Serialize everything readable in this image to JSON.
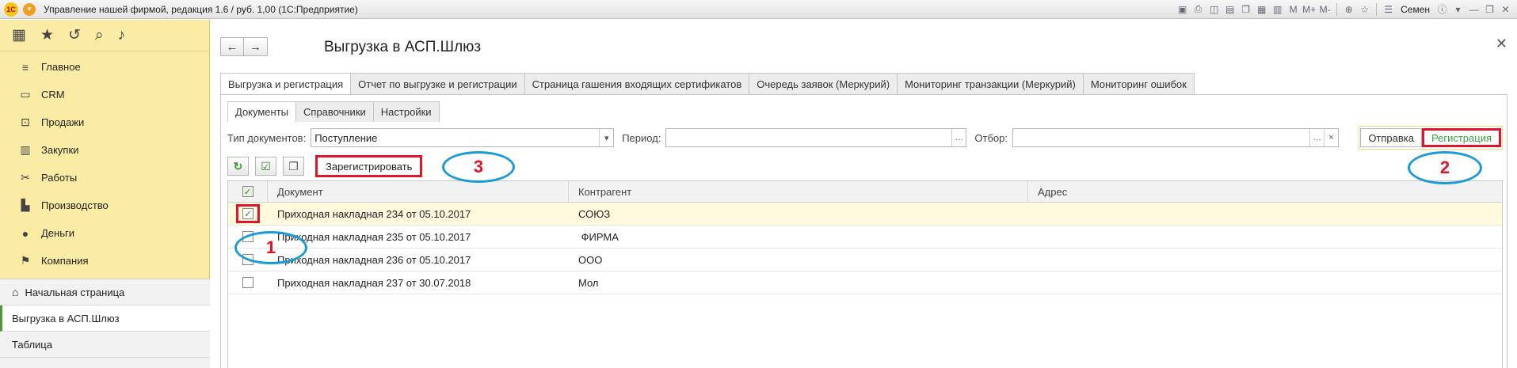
{
  "window": {
    "title": "Управление нашей фирмой, редакция 1.6 / руб. 1,00  (1С:Предприятие)",
    "user": "Семен",
    "app_badge": "1С"
  },
  "sidebar": {
    "items": [
      {
        "label": "Главное",
        "icon": "lines-icon"
      },
      {
        "label": "CRM",
        "icon": "crm-icon"
      },
      {
        "label": "Продажи",
        "icon": "cart-icon"
      },
      {
        "label": "Закупки",
        "icon": "barcode-icon"
      },
      {
        "label": "Работы",
        "icon": "tools-icon"
      },
      {
        "label": "Производство",
        "icon": "factory-icon"
      },
      {
        "label": "Деньги",
        "icon": "money-icon"
      },
      {
        "label": "Компания",
        "icon": "flag-icon"
      }
    ],
    "bottom": {
      "home": "Начальная страница",
      "current": "Выгрузка в АСП.Шлюз",
      "table": "Таблица"
    }
  },
  "page": {
    "title": "Выгрузка в АСП.Шлюз"
  },
  "tabs": [
    "Выгрузка и регистрация",
    "Отчет по выгрузке и регистрации",
    "Страница гашения входящих сертификатов",
    "Очередь заявок (Меркурий)",
    "Мониторинг транзакции (Меркурий)",
    "Мониторинг ошибок"
  ],
  "subtabs": [
    "Документы",
    "Справочники",
    "Настройки"
  ],
  "filters": {
    "doc_type_label": "Тип документов:",
    "doc_type_value": "Поступление",
    "period_label": "Период:",
    "period_value": "",
    "filter_label": "Отбор:",
    "filter_value": "",
    "toggle_send": "Отправка",
    "toggle_register": "Регистрация"
  },
  "commands": {
    "register": "Зарегистрировать"
  },
  "table": {
    "columns": [
      "Документ",
      "Контрагент",
      "Адрес"
    ],
    "rows": [
      {
        "checked": true,
        "document": "Приходная накладная 234 от 05.10.2017",
        "counterparty": "СОЮЗ",
        "address": ""
      },
      {
        "checked": false,
        "document": "Приходная накладная 235 от 05.10.2017",
        "counterparty": " ФИРМА",
        "address": ""
      },
      {
        "checked": false,
        "document": "Приходная накладная 236 от 05.10.2017",
        "counterparty": "ООО",
        "address": ""
      },
      {
        "checked": false,
        "document": "Приходная накладная 237 от 30.07.2018",
        "counterparty": "Мол",
        "address": ""
      }
    ]
  },
  "annotations": {
    "n1": "1",
    "n2": "2",
    "n3": "3"
  },
  "colors": {
    "sidebar": "#fbeca5",
    "highlight_red": "#e0142a",
    "marker_blue": "#1a9ad6",
    "active_green": "#3aa346"
  }
}
